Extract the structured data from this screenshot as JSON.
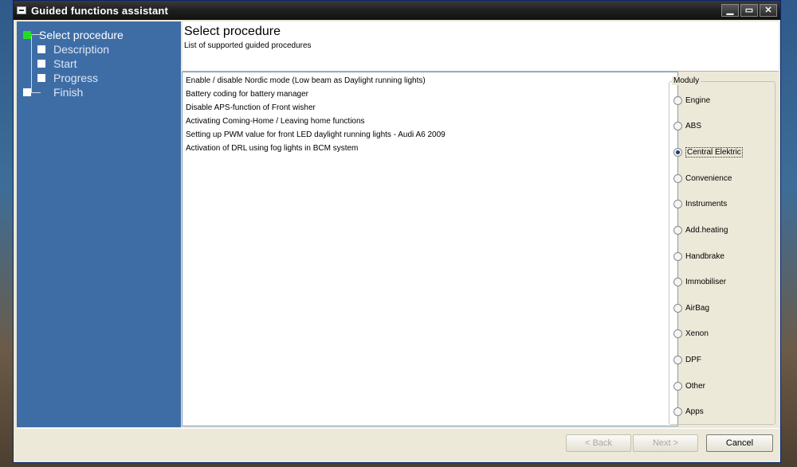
{
  "window": {
    "title": "Guided functions assistant",
    "minimize_glyph": "▁",
    "maximize_glyph": "▭",
    "close_glyph": "✕"
  },
  "steps": [
    {
      "label": "Select procedure",
      "active": true
    },
    {
      "label": "Description",
      "active": false
    },
    {
      "label": "Start",
      "active": false
    },
    {
      "label": "Progress",
      "active": false
    },
    {
      "label": "Finish",
      "active": false
    }
  ],
  "header": {
    "title": "Select procedure",
    "subtitle": "List of supported guided procedures"
  },
  "procedures": [
    "Enable / disable Nordic mode (Low beam as Daylight running lights)",
    "Battery coding for battery manager",
    "Disable APS-function of Front wisher",
    "Activating Coming-Home / Leaving home  functions",
    "Setting up PWM value for front LED daylight running lights - Audi A6 2009",
    "Activation of DRL using fog lights in BCM system"
  ],
  "moduly": {
    "legend": "Moduly",
    "selected": "Central Elektric",
    "options": [
      "Engine",
      "ABS",
      "Central Elektric",
      "Convenience",
      "Instruments",
      "Add.heating",
      "Handbrake",
      "Immobiliser",
      "AirBag",
      "Xenon",
      "DPF",
      "Other",
      "Apps"
    ]
  },
  "footer": {
    "back_label": "< Back",
    "next_label": "Next >",
    "cancel_label": "Cancel"
  },
  "colors": {
    "sidebar": "#3e6da6",
    "active_step": "#22dd22",
    "titlebar": "#1f1f1f"
  }
}
